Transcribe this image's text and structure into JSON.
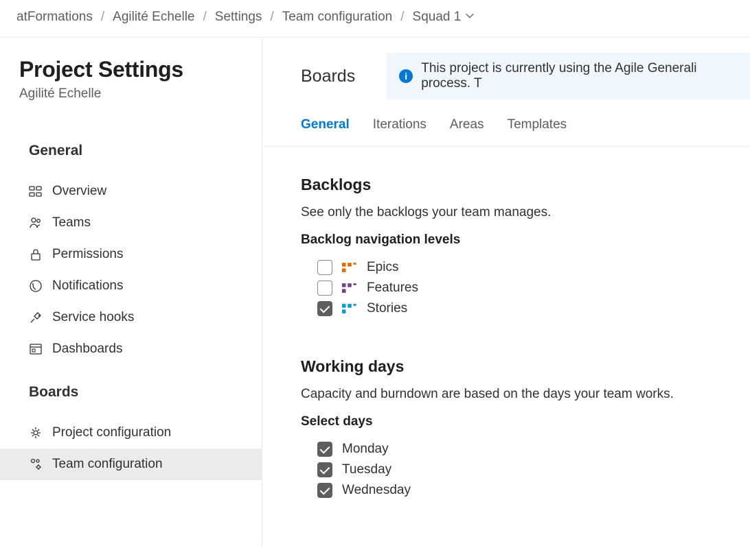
{
  "breadcrumb": {
    "items": [
      {
        "label": "atFormations"
      },
      {
        "label": "Agilité Echelle"
      },
      {
        "label": "Settings"
      },
      {
        "label": "Team configuration"
      },
      {
        "label": "Squad 1"
      }
    ]
  },
  "sidebar": {
    "title": "Project Settings",
    "subtitle": "Agilité Echelle",
    "sections": [
      {
        "heading": "General",
        "items": [
          {
            "label": "Overview"
          },
          {
            "label": "Teams"
          },
          {
            "label": "Permissions"
          },
          {
            "label": "Notifications"
          },
          {
            "label": "Service hooks"
          },
          {
            "label": "Dashboards"
          }
        ]
      },
      {
        "heading": "Boards",
        "items": [
          {
            "label": "Project configuration"
          },
          {
            "label": "Team configuration"
          }
        ]
      }
    ]
  },
  "content": {
    "title": "Boards",
    "info_message": "This project is currently using the Agile Generali process. T",
    "tabs": [
      {
        "label": "General"
      },
      {
        "label": "Iterations"
      },
      {
        "label": "Areas"
      },
      {
        "label": "Templates"
      }
    ]
  },
  "backlogs": {
    "heading": "Backlogs",
    "subtext": "See only the backlogs your team manages.",
    "levels_heading": "Backlog navigation levels",
    "levels": [
      {
        "label": "Epics",
        "checked": false,
        "color": "#e06c00"
      },
      {
        "label": "Features",
        "checked": false,
        "color": "#773b93"
      },
      {
        "label": "Stories",
        "checked": true,
        "color": "#009ccc"
      }
    ]
  },
  "workingdays": {
    "heading": "Working days",
    "subtext": "Capacity and burndown are based on the days your team works.",
    "select_heading": "Select days",
    "days": [
      {
        "label": "Monday",
        "checked": true
      },
      {
        "label": "Tuesday",
        "checked": true
      },
      {
        "label": "Wednesday",
        "checked": true
      }
    ]
  }
}
